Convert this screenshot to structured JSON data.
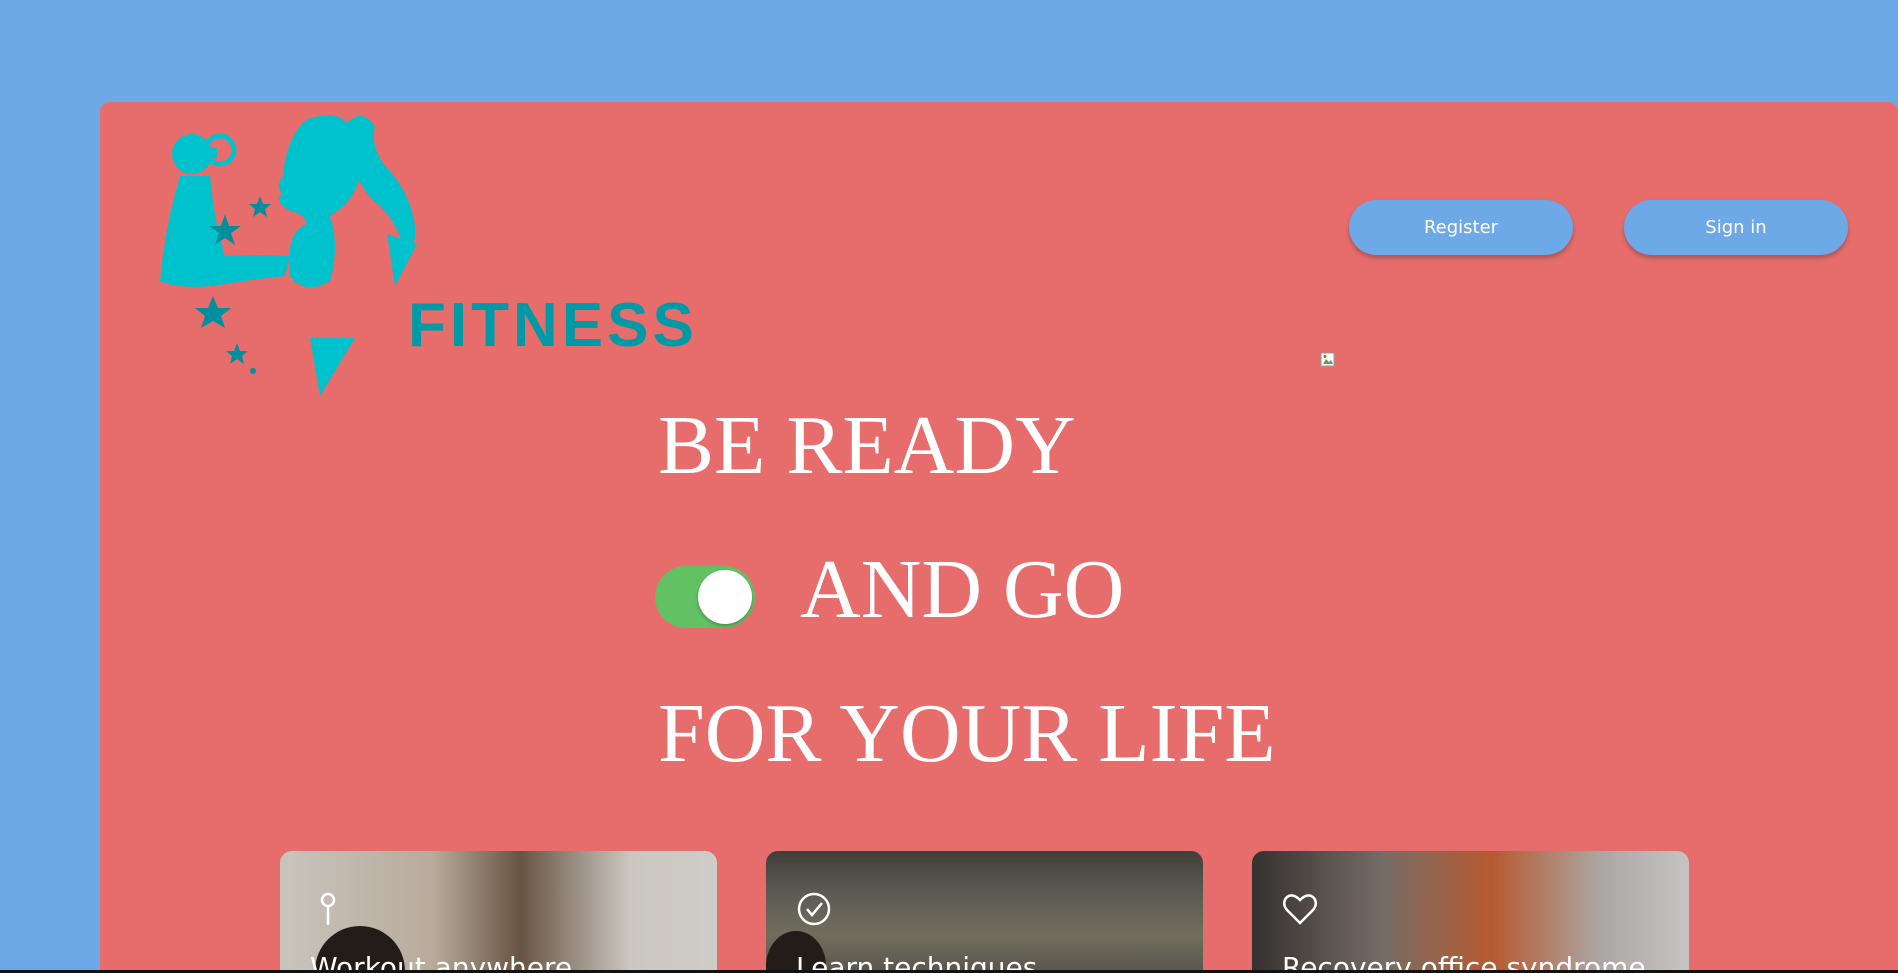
{
  "header": {
    "logo_text": "FITNESS",
    "register_label": "Register",
    "signin_label": "Sign in"
  },
  "hero": {
    "line1": "BE READY",
    "line2": "AND GO",
    "line3": "FOR YOUR LIFE",
    "toggle_on": true
  },
  "cards": [
    {
      "title": "Workout anywhere",
      "icon": "pin-icon"
    },
    {
      "title": "Learn techniques",
      "icon": "check-circle-icon"
    },
    {
      "title": "Recovery office syndrome",
      "icon": "heart-icon"
    }
  ],
  "colors": {
    "background": "#6ea9e7",
    "panel": "#e76d6d",
    "logo": "#00c2cc",
    "toggle": "#62c163"
  }
}
